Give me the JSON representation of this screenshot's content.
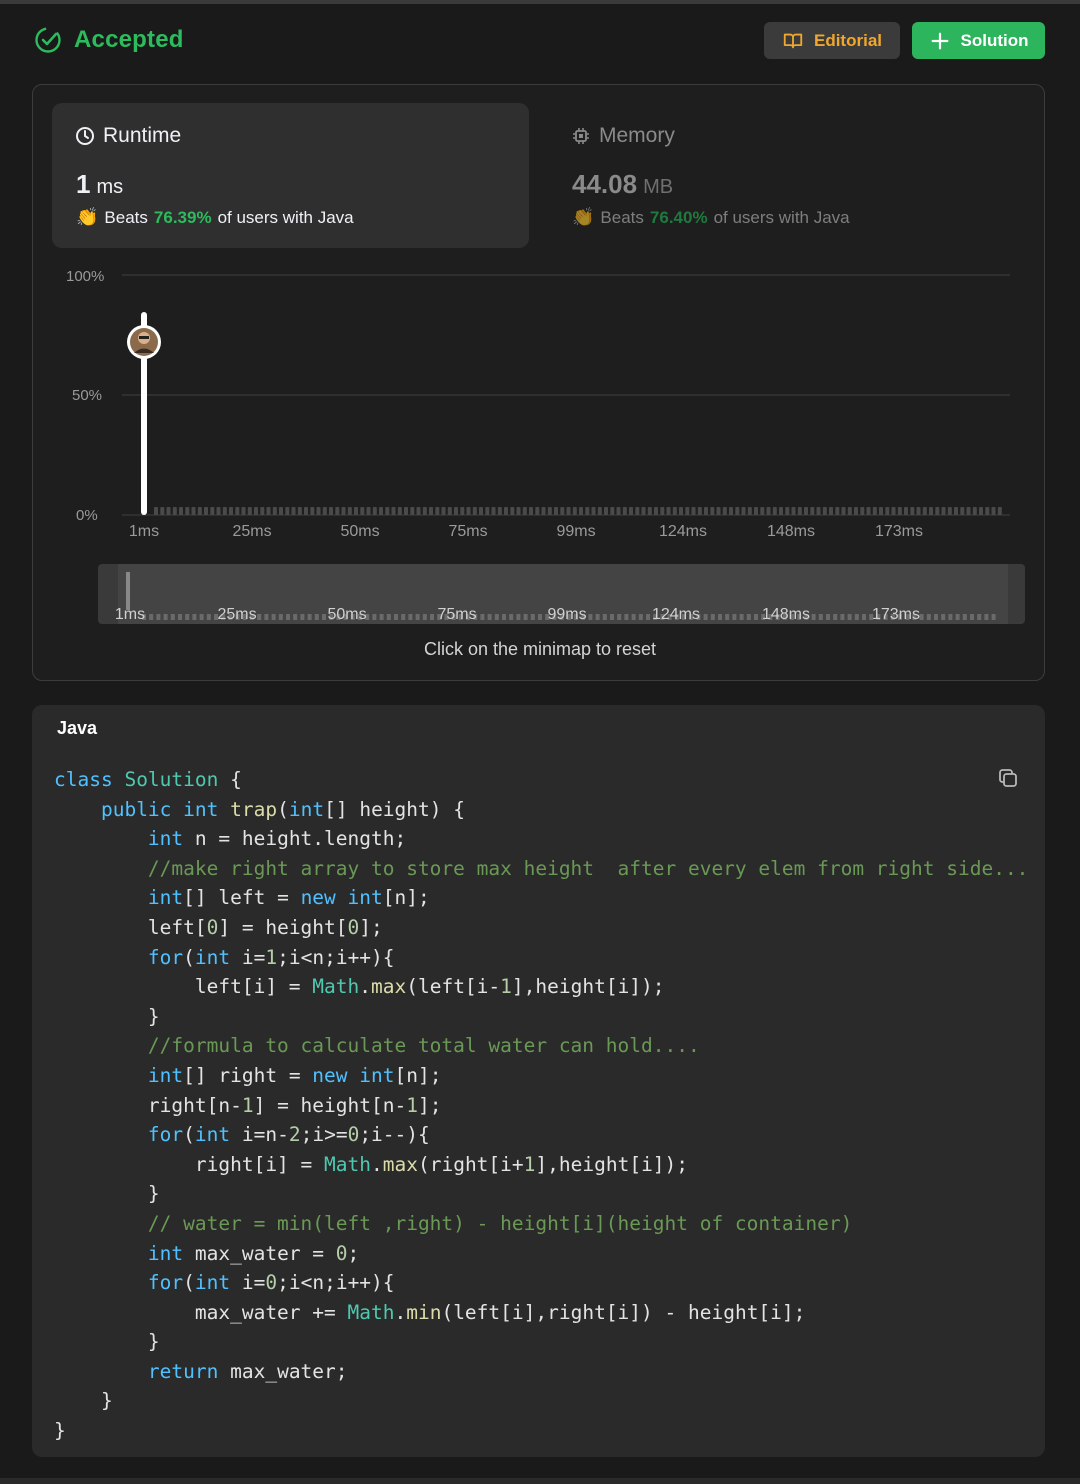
{
  "header": {
    "status": "Accepted",
    "editorial_label": "Editorial",
    "solution_label": "Solution"
  },
  "runtime": {
    "label": "Runtime",
    "value": "1",
    "unit": "ms",
    "beats_prefix": "Beats",
    "beats_pct": "76.39%",
    "beats_suffix": "of users with Java"
  },
  "memory": {
    "label": "Memory",
    "value": "44.08",
    "unit": "MB",
    "beats_prefix": "Beats",
    "beats_pct": "76.40%",
    "beats_suffix": "of users with Java"
  },
  "chart_data": {
    "type": "bar",
    "ylabels": [
      "100%",
      "50%",
      "0%"
    ],
    "ylim": [
      0,
      100
    ],
    "xlabels": [
      "1ms",
      "25ms",
      "50ms",
      "75ms",
      "99ms",
      "124ms",
      "148ms",
      "173ms"
    ],
    "highlight": {
      "x": "1ms",
      "value": 76.39
    },
    "grid": true
  },
  "minimap": {
    "labels": [
      "1ms",
      "25ms",
      "50ms",
      "75ms",
      "99ms",
      "124ms",
      "148ms",
      "173ms"
    ],
    "hint": "Click on the minimap to reset"
  },
  "code": {
    "language": "Java"
  },
  "colors": {
    "accent_green": "#2cbb5d",
    "editorial_orange": "#f0a72d"
  },
  "icons": [
    "check-circle-icon",
    "book-icon",
    "plus-icon",
    "clock-icon",
    "chip-icon",
    "clap-icon",
    "copy-icon",
    "avatar"
  ]
}
